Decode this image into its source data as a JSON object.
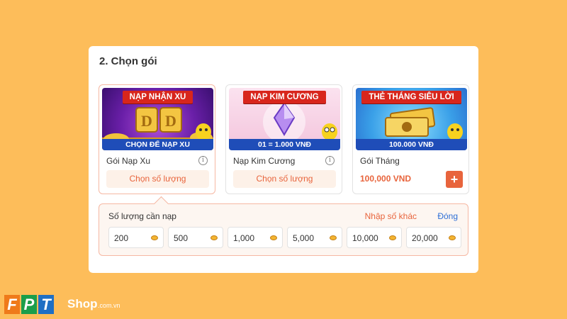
{
  "section": {
    "title": "2. Chọn gói"
  },
  "cards": [
    {
      "banner": "NẠP NHẬN XU",
      "caption": "CHỌN ĐỂ NẠP XU",
      "name": "Gói Nạp Xu",
      "action": "Chọn số lượng",
      "selected": true
    },
    {
      "banner": "NẠP KIM CƯƠNG",
      "caption": "01 = 1.000 VNĐ",
      "name": "Nạp Kim Cương",
      "action": "Chọn số lượng",
      "selected": false
    },
    {
      "banner": "THẺ THÁNG SIÊU LỜI",
      "caption": "100.000 VNĐ",
      "name": "Gói Tháng",
      "price": "100,000 VND",
      "add": "+",
      "selected": false
    }
  ],
  "quantity": {
    "label": "Số lượng cần nạp",
    "other": "Nhập số khác",
    "close": "Đóng",
    "options": [
      "200",
      "500",
      "1,000",
      "5,000",
      "10,000",
      "20,000"
    ]
  },
  "brand": {
    "letters": [
      "F",
      "P",
      "T"
    ],
    "shop": "Shop",
    "domain": ".com.vn"
  },
  "colors": {
    "accent": "#e8643c",
    "link": "#2f6fd6",
    "background": "#fdbd5a"
  }
}
